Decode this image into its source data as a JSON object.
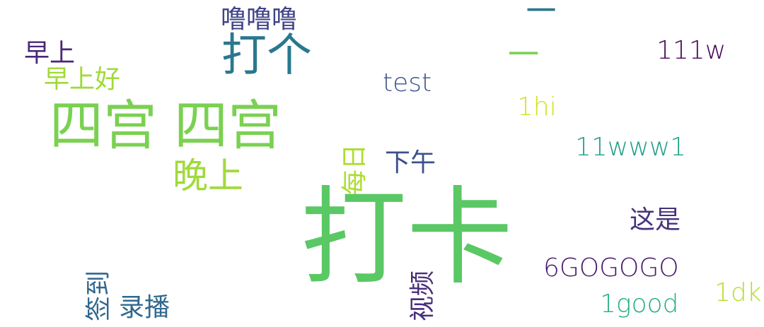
{
  "word_cloud": {
    "words": [
      {
        "text": "打卡",
        "color": "#5ac864"
      },
      {
        "text": "四宫 四宫",
        "color": "#7ad151"
      },
      {
        "text": "打个",
        "color": "#2a788e"
      },
      {
        "text": "噜噜噜",
        "color": "#414487"
      },
      {
        "text": "一",
        "color": "#7ad151"
      },
      {
        "text": "二",
        "color": "#2a788e"
      },
      {
        "text": "111w",
        "color": "#440154"
      },
      {
        "text": "早上",
        "color": "#482878"
      },
      {
        "text": "早上好",
        "color": "#a0da39"
      },
      {
        "text": "test",
        "color": "#3b528b"
      },
      {
        "text": "1hi",
        "color": "#d2e21b"
      },
      {
        "text": "11www1",
        "color": "#1f9e89"
      },
      {
        "text": "晚上",
        "color": "#a0da39"
      },
      {
        "text": "每日",
        "color": "#addc30"
      },
      {
        "text": "下午",
        "color": "#3b528b"
      },
      {
        "text": "这是",
        "color": "#46327e"
      },
      {
        "text": "6GOGOGO",
        "color": "#481a6c"
      },
      {
        "text": "签到",
        "color": "#31688e"
      },
      {
        "text": "录播",
        "color": "#31688e"
      },
      {
        "text": "视频",
        "color": "#472d7b"
      },
      {
        "text": "1good",
        "color": "#26ad81"
      },
      {
        "text": "1dk",
        "color": "#b5de2b"
      }
    ]
  }
}
